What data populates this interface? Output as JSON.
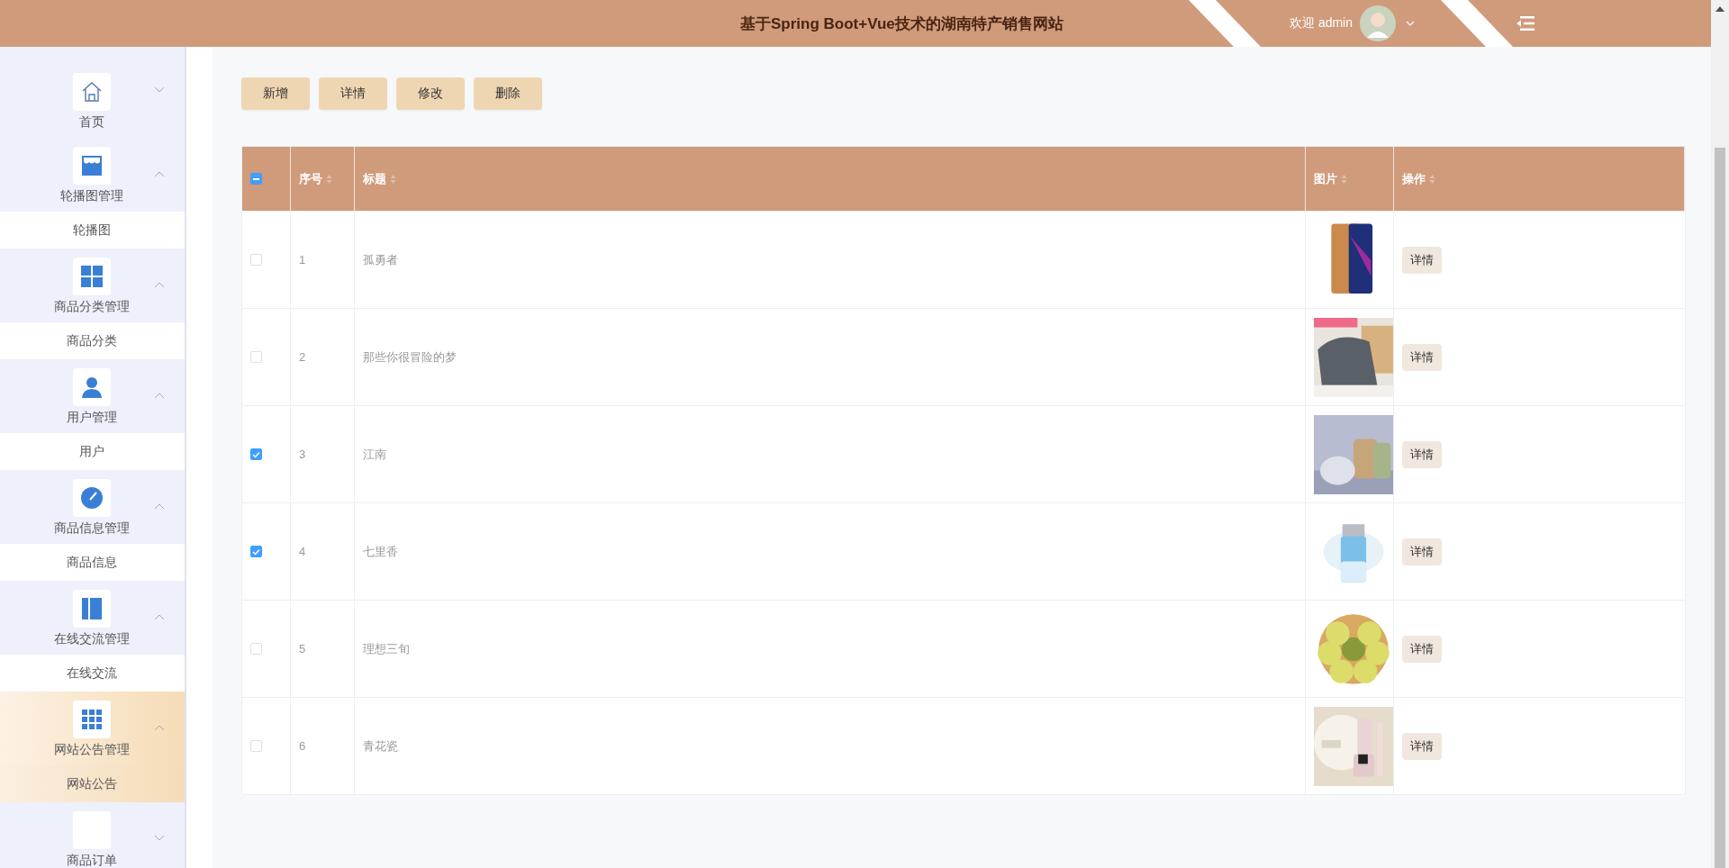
{
  "header": {
    "title": "基于Spring Boot+Vue技术的湖南特产销售网站",
    "welcome": "欢迎 admin"
  },
  "sidebar": {
    "menus": [
      {
        "label": "首页",
        "expanded": false,
        "selected": false
      },
      {
        "label": "轮播图管理",
        "expanded": true,
        "selected": false,
        "children": [
          {
            "label": "轮播图",
            "selected": false
          }
        ]
      },
      {
        "label": "商品分类管理",
        "expanded": true,
        "selected": false,
        "children": [
          {
            "label": "商品分类",
            "selected": false
          }
        ]
      },
      {
        "label": "用户管理",
        "expanded": true,
        "selected": false,
        "children": [
          {
            "label": "用户",
            "selected": false
          }
        ]
      },
      {
        "label": "商品信息管理",
        "expanded": true,
        "selected": false,
        "children": [
          {
            "label": "商品信息",
            "selected": false
          }
        ]
      },
      {
        "label": "在线交流管理",
        "expanded": true,
        "selected": false,
        "children": [
          {
            "label": "在线交流",
            "selected": false
          }
        ]
      },
      {
        "label": "网站公告管理",
        "expanded": true,
        "selected": true,
        "children": [
          {
            "label": "网站公告",
            "selected": true
          }
        ]
      },
      {
        "label": "商品订单",
        "expanded": false,
        "selected": false
      }
    ]
  },
  "toolbar": {
    "buttons": [
      "新增",
      "详情",
      "修改",
      "删除"
    ]
  },
  "table": {
    "header_checkbox": {
      "indeterminate": true
    },
    "columns": [
      "序号",
      "标题",
      "图片",
      "操作"
    ],
    "rows": [
      {
        "index": "1",
        "title": "孤勇者",
        "checked": false,
        "action": "详情"
      },
      {
        "index": "2",
        "title": "那些你很冒险的梦",
        "checked": false,
        "action": "详情"
      },
      {
        "index": "3",
        "title": "江南",
        "checked": true,
        "action": "详情"
      },
      {
        "index": "4",
        "title": "七里香",
        "checked": true,
        "action": "详情"
      },
      {
        "index": "5",
        "title": "理想三旬",
        "checked": false,
        "action": "详情"
      },
      {
        "index": "6",
        "title": "青花瓷",
        "checked": false,
        "action": "详情"
      }
    ]
  }
}
